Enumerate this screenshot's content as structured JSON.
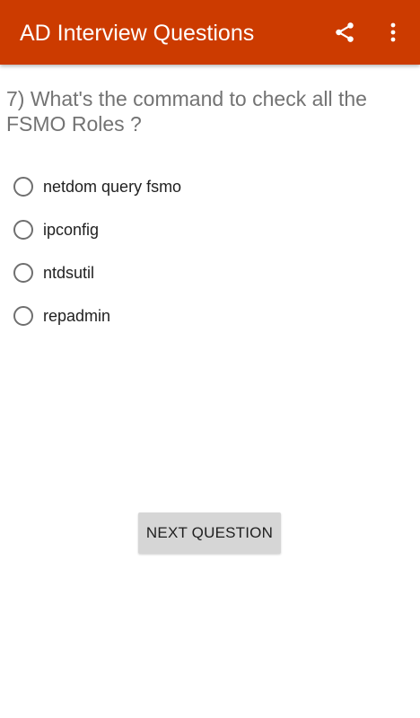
{
  "toolbar": {
    "title": "AD Interview Questions",
    "share_icon": "share-icon",
    "overflow_icon": "more-vert-icon",
    "background_color": "#cc3b00"
  },
  "question": {
    "text": "7) What's the command to check all the FSMO Roles ?"
  },
  "options": [
    {
      "label": "netdom query fsmo",
      "selected": false
    },
    {
      "label": "ipconfig",
      "selected": false
    },
    {
      "label": "ntdsutil",
      "selected": false
    },
    {
      "label": "repadmin",
      "selected": false
    }
  ],
  "next_button": {
    "label": "NEXT QUESTION"
  }
}
